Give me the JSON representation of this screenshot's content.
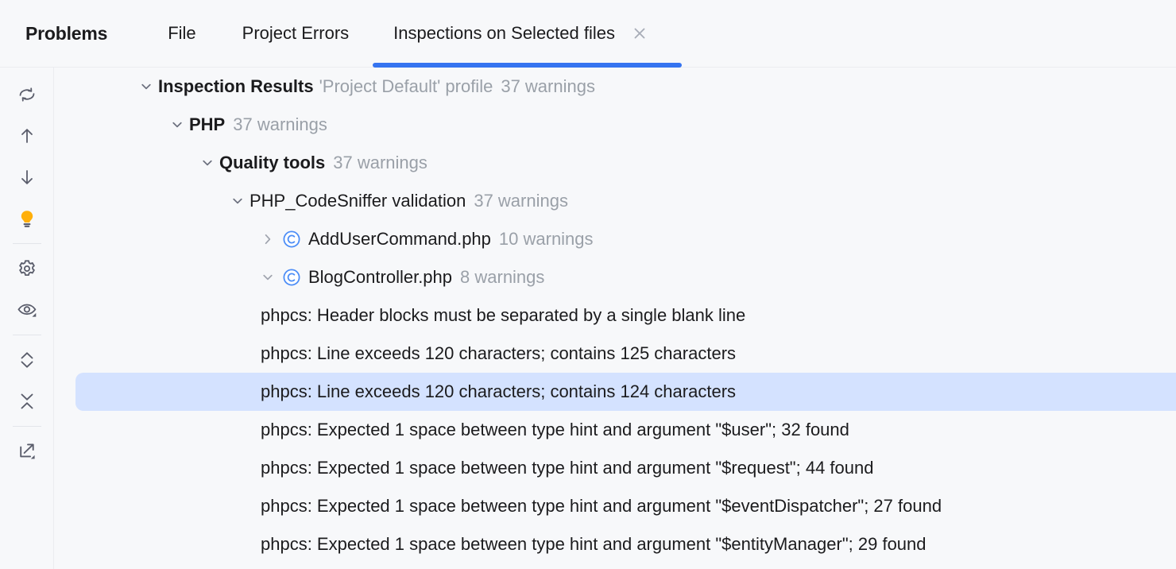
{
  "window": {
    "panel_title": "Problems",
    "background": "#F7F8FA",
    "accent": "#3574F0",
    "selection_color": "#D4E2FF"
  },
  "tabs": [
    {
      "label": "File",
      "active": false,
      "closable": false
    },
    {
      "label": "Project Errors",
      "active": false,
      "closable": false
    },
    {
      "label": "Inspections on Selected files",
      "active": true,
      "closable": true
    }
  ],
  "toolbar": {
    "buttons": [
      {
        "name": "rerun-icon",
        "tooltip": "Rerun inspection"
      },
      {
        "name": "previous-problem-arrow-up-icon",
        "tooltip": "Previous problem"
      },
      {
        "name": "next-problem-arrow-down-icon",
        "tooltip": "Next problem"
      },
      {
        "name": "lightbulb-icon",
        "tooltip": "Show quick fixes",
        "color": "#FFAF0A"
      },
      {
        "name": "gear-icon",
        "tooltip": "Edit settings"
      },
      {
        "name": "eye-dropdown-icon",
        "tooltip": "View options"
      },
      {
        "name": "expand-all-icon",
        "tooltip": "Expand all"
      },
      {
        "name": "collapse-all-icon",
        "tooltip": "Collapse all"
      },
      {
        "name": "export-dropdown-icon",
        "tooltip": "Export"
      }
    ]
  },
  "tree": {
    "rows": [
      {
        "id": "inspection-results",
        "level": 0,
        "twisty": "down",
        "icon": null,
        "label": "Inspection Results",
        "label_bold": true,
        "profile": "'Project Default' profile",
        "meta": "37 warnings",
        "selected": false
      },
      {
        "id": "php",
        "level": 1,
        "twisty": "down",
        "icon": null,
        "label": "PHP",
        "label_bold": true,
        "profile": null,
        "meta": "37 warnings",
        "selected": false
      },
      {
        "id": "quality-tools",
        "level": 2,
        "twisty": "down",
        "icon": null,
        "label": "Quality tools",
        "label_bold": true,
        "profile": null,
        "meta": "37 warnings",
        "selected": false
      },
      {
        "id": "php-codesniffer-validation",
        "level": 3,
        "twisty": "down",
        "icon": null,
        "label": "PHP_CodeSniffer validation",
        "label_bold": false,
        "profile": null,
        "meta": "37 warnings",
        "selected": false
      },
      {
        "id": "adduser-command-php",
        "level": 4,
        "twisty": "right",
        "icon": "php-class-icon",
        "label": "AddUserCommand.php",
        "label_bold": false,
        "profile": null,
        "meta": "10 warnings",
        "selected": false
      },
      {
        "id": "blog-controller-php",
        "level": 4,
        "twisty": "down",
        "icon": "php-class-icon",
        "label": "BlogController.php",
        "label_bold": false,
        "profile": null,
        "meta": "8 warnings",
        "selected": false
      },
      {
        "id": "problem-header-blocks",
        "level": 5,
        "twisty": "none",
        "icon": null,
        "label": "phpcs: Header blocks must be separated by a single blank line",
        "label_bold": false,
        "profile": null,
        "meta": null,
        "selected": false
      },
      {
        "id": "problem-line-125",
        "level": 5,
        "twisty": "none",
        "icon": null,
        "label": "phpcs: Line exceeds 120 characters; contains 125 characters",
        "label_bold": false,
        "profile": null,
        "meta": null,
        "selected": false
      },
      {
        "id": "problem-line-124",
        "level": 5,
        "twisty": "none",
        "icon": null,
        "label": "phpcs: Line exceeds 120 characters; contains 124 characters",
        "label_bold": false,
        "profile": null,
        "meta": null,
        "selected": true
      },
      {
        "id": "problem-type-hint-user",
        "level": 5,
        "twisty": "none",
        "icon": null,
        "label": "phpcs: Expected 1 space between type hint and argument \"$user\"; 32 found",
        "label_bold": false,
        "profile": null,
        "meta": null,
        "selected": false
      },
      {
        "id": "problem-type-hint-request",
        "level": 5,
        "twisty": "none",
        "icon": null,
        "label": "phpcs: Expected 1 space between type hint and argument \"$request\"; 44 found",
        "label_bold": false,
        "profile": null,
        "meta": null,
        "selected": false
      },
      {
        "id": "problem-type-hint-eventdispatcher",
        "level": 5,
        "twisty": "none",
        "icon": null,
        "label": "phpcs: Expected 1 space between type hint and argument \"$eventDispatcher\"; 27 found",
        "label_bold": false,
        "profile": null,
        "meta": null,
        "selected": false
      },
      {
        "id": "problem-type-hint-entitymanager",
        "level": 5,
        "twisty": "none",
        "icon": null,
        "label": "phpcs: Expected 1 space between type hint and argument \"$entityManager\"; 29 found",
        "label_bold": false,
        "profile": null,
        "meta": null,
        "selected": false
      }
    ]
  }
}
